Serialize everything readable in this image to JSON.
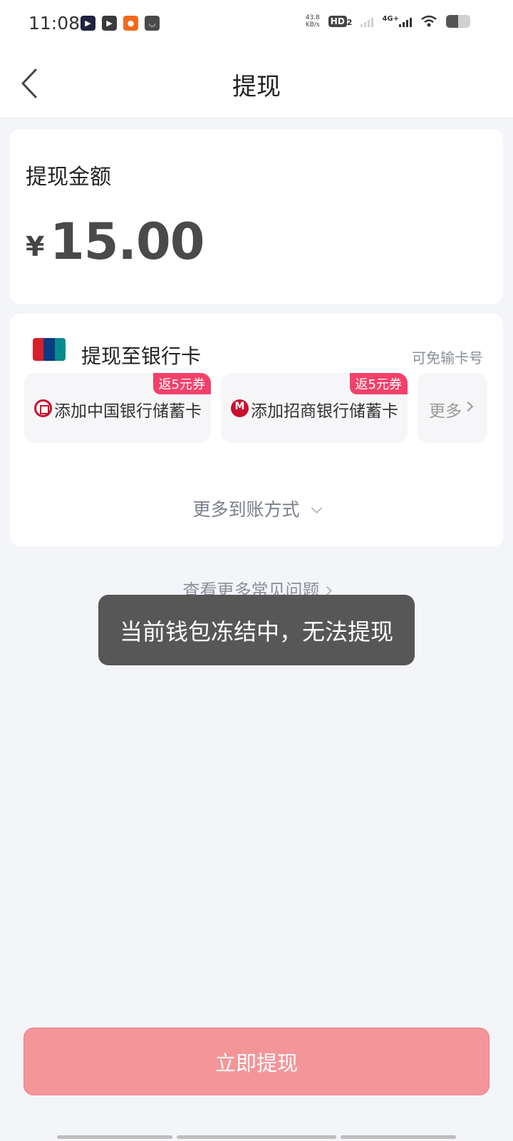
{
  "status_bar": {
    "time": "11:08",
    "net_speed_value": "43.8",
    "net_speed_unit": "KB/s",
    "hd_badge": "HD",
    "hd_sub": "2",
    "network_type": "4G+",
    "app_icons": [
      "tv-app-icon",
      "video-app-icon",
      "shopping-app-icon",
      "bag-app-icon"
    ]
  },
  "nav": {
    "title": "提现"
  },
  "amount": {
    "label": "提现金额",
    "currency": "¥",
    "value": "15.00"
  },
  "withdraw_method": {
    "title": "提现至银行卡",
    "hint": "可免输卡号",
    "options": [
      {
        "label": "添加中国银行储蓄卡",
        "badge": "返5元券"
      },
      {
        "label": "添加招商银行储蓄卡",
        "badge": "返5元券"
      }
    ],
    "more_label": "更多",
    "more_methods_label": "更多到账方式"
  },
  "faq": {
    "label": "查看更多常见问题"
  },
  "toast": {
    "message": "当前钱包冻结中，无法提现"
  },
  "submit": {
    "label": "立即提现"
  },
  "colors": {
    "accent": "#f49599",
    "badge": "#f2416a",
    "background": "#f4f5f9",
    "toast": "#575757"
  }
}
